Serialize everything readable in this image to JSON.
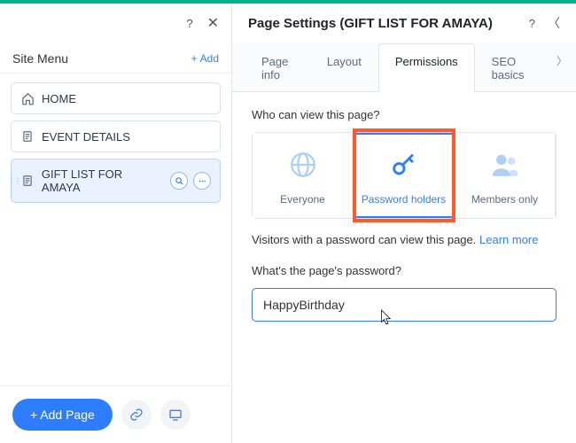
{
  "sidebar": {
    "heading": "Site Menu",
    "add": "Add",
    "items": [
      {
        "label": "HOME",
        "icon": "home-icon"
      },
      {
        "label": "EVENT DETAILS",
        "icon": "page-icon"
      },
      {
        "label": "GIFT LIST FOR AMAYA",
        "icon": "page-icon",
        "selected": true
      }
    ],
    "footer": {
      "add_page": "+ Add Page"
    }
  },
  "settings": {
    "title": "Page Settings (GIFT LIST FOR AMAYA)",
    "tabs": [
      "Page info",
      "Layout",
      "Permissions",
      "SEO basics"
    ],
    "active_tab": 2,
    "permissions": {
      "question": "Who can view this page?",
      "options": [
        {
          "label": "Everyone",
          "icon": "globe"
        },
        {
          "label": "Password holders",
          "icon": "key"
        },
        {
          "label": "Members only",
          "icon": "members"
        }
      ],
      "selected": 1,
      "helper_prefix": "Visitors with a password can view this page. ",
      "helper_link": "Learn more",
      "password_label": "What's the page's password?",
      "password_value": "HappyBirthday"
    }
  },
  "colors": {
    "accent": "#2f7dff",
    "highlight": "#ff5a2b",
    "topbar": "#00b48c"
  }
}
